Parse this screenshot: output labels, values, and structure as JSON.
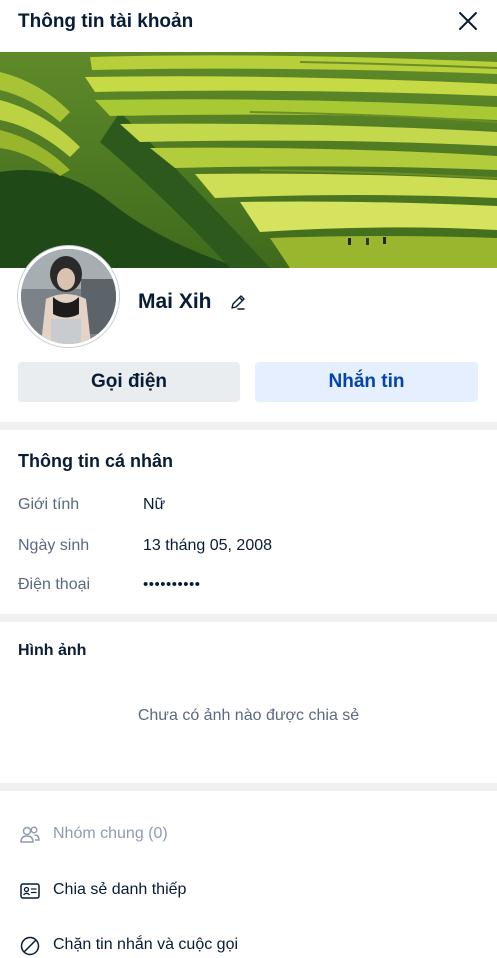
{
  "header": {
    "title": "Thông tin tài khoản",
    "close_icon": "close-icon"
  },
  "profile": {
    "name": "Mai Xih",
    "edit_icon": "pencil-icon",
    "call_label": "Gọi điện",
    "message_label": "Nhắn tin"
  },
  "personal_info": {
    "title": "Thông tin cá nhân",
    "rows": [
      {
        "label": "Giới tính",
        "value": "Nữ"
      },
      {
        "label": "Ngày sinh",
        "value": "13 tháng 05, 2008"
      },
      {
        "label": "Điện thoại",
        "value": "••••••••••"
      }
    ]
  },
  "photos": {
    "title": "Hình ảnh",
    "empty_text": "Chưa có ảnh nào được chia sẻ"
  },
  "menu": [
    {
      "label": "Nhóm chung (0)",
      "icon": "group-icon",
      "disabled": true
    },
    {
      "label": "Chia sẻ danh thiếp",
      "icon": "contact-card-icon",
      "disabled": false
    },
    {
      "label": "Chặn tin nhắn và cuộc gọi",
      "icon": "block-icon",
      "disabled": false
    }
  ],
  "colors": {
    "accent": "#0045ad",
    "accent_bg": "#e5efff",
    "muted_text": "#5a6981",
    "divider": "#eef0f1"
  }
}
